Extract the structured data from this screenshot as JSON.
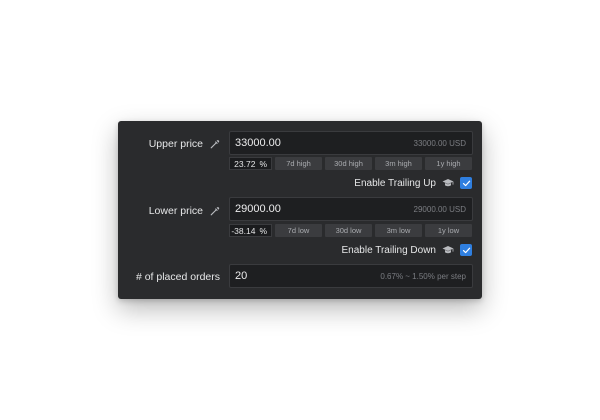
{
  "upper": {
    "label": "Upper price",
    "value": "33000.00",
    "hint": "33000.00 USD",
    "percent": "23.72",
    "percent_sign": "%",
    "chips": [
      "7d high",
      "30d high",
      "3m high",
      "1y high"
    ],
    "trailing_label": "Enable Trailing Up",
    "trailing_checked": true
  },
  "lower": {
    "label": "Lower price",
    "value": "29000.00",
    "hint": "29000.00 USD",
    "percent": "-38.14",
    "percent_sign": "%",
    "chips": [
      "7d low",
      "30d low",
      "3m low",
      "1y low"
    ],
    "trailing_label": "Enable Trailing Down",
    "trailing_checked": true
  },
  "orders": {
    "label": "# of placed orders",
    "value": "20",
    "hint": "0.67% ~ 1.50% per step"
  },
  "colors": {
    "panel_bg": "#2a2b2d",
    "field_bg": "#1e1f21",
    "chip_bg": "#3b3c3f",
    "accent": "#2f7fe0"
  },
  "icons": {
    "price_picker": "pipette-icon",
    "info": "graduation-cap-icon",
    "check": "check-icon"
  }
}
